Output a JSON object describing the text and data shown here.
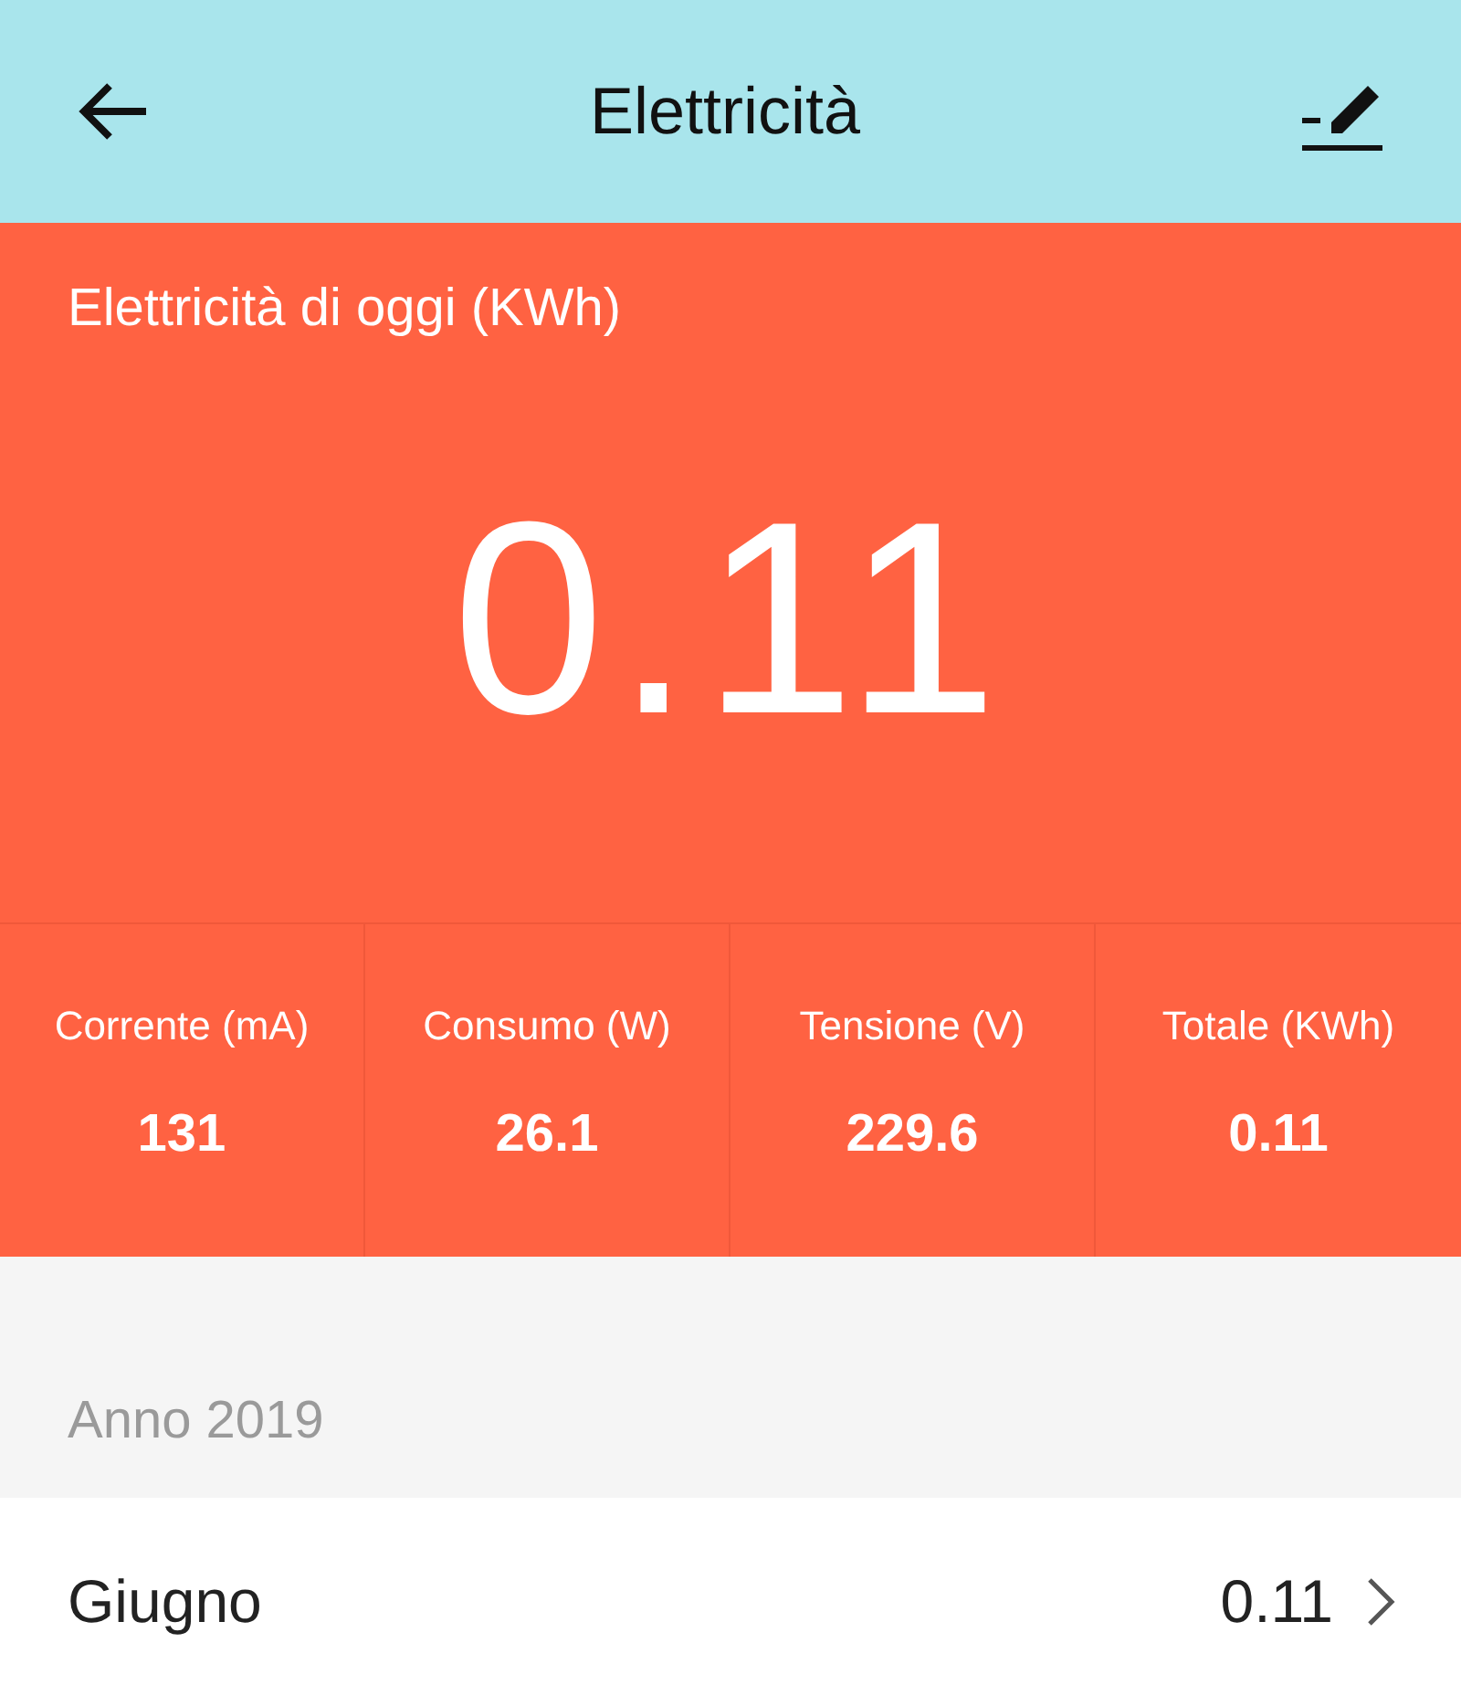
{
  "header": {
    "title": "Elettricità"
  },
  "today": {
    "label": "Elettricità di oggi (KWh)",
    "value": "0.11"
  },
  "stats": [
    {
      "label": "Corrente (mA)",
      "value": "131"
    },
    {
      "label": "Consumo (W)",
      "value": "26.1"
    },
    {
      "label": "Tensione (V)",
      "value": "229.6"
    },
    {
      "label": "Totale (KWh)",
      "value": "0.11"
    }
  ],
  "year": {
    "label": "Anno 2019"
  },
  "months": [
    {
      "name": "Giugno",
      "value": "0.11"
    }
  ]
}
